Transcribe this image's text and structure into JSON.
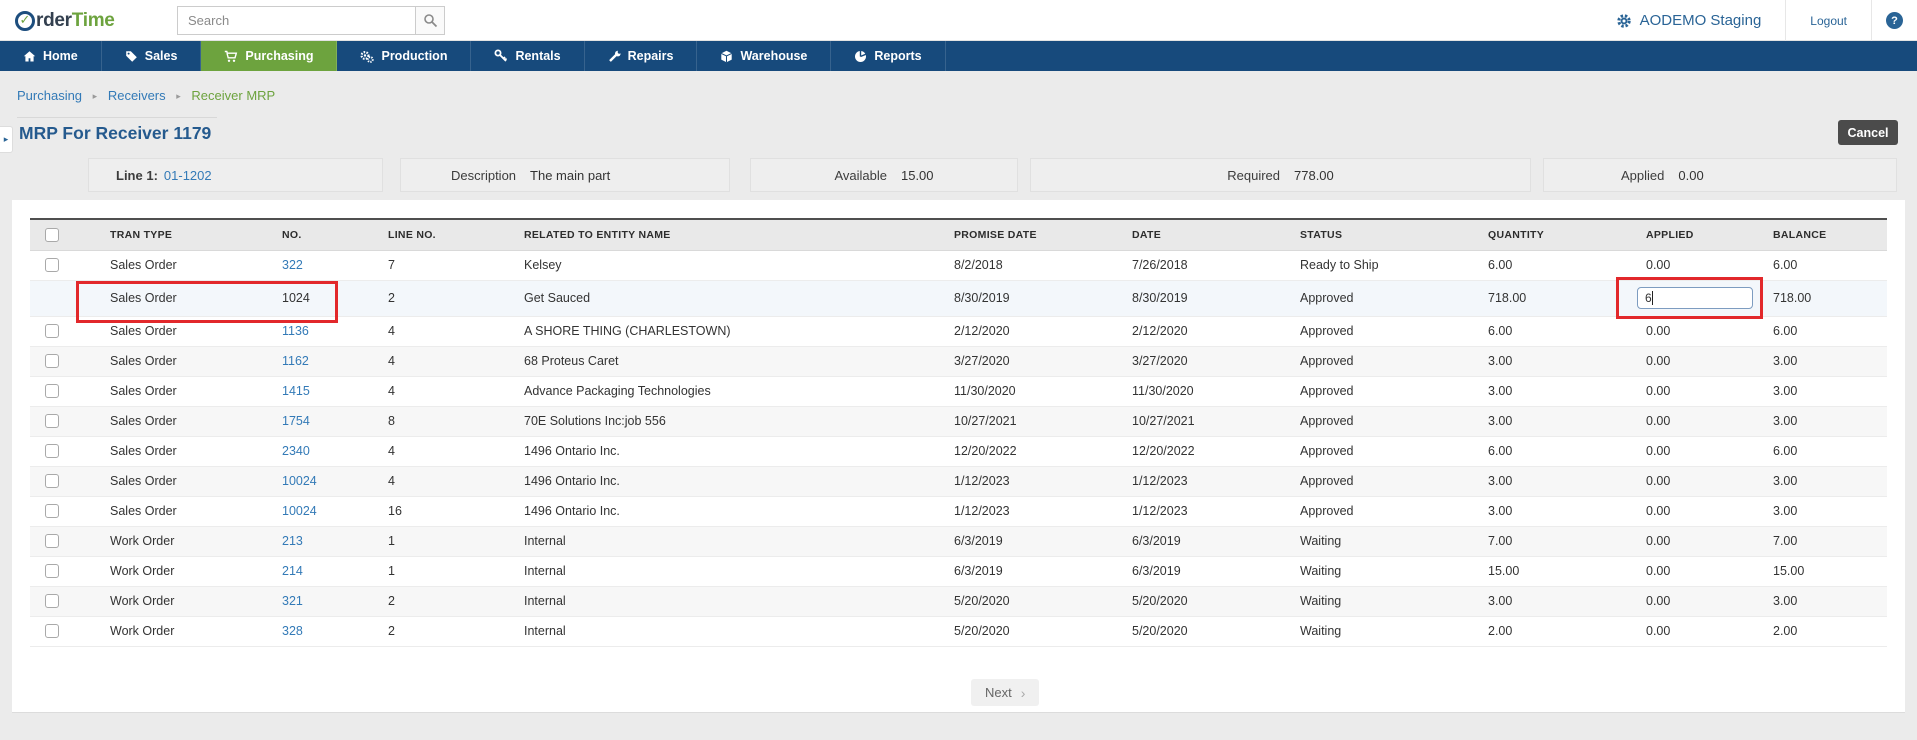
{
  "brand": {
    "logo_prefix": "rder",
    "logo_suffix": "Time",
    "logo_check": "✓"
  },
  "topbar": {
    "search_placeholder": "Search",
    "account_label": "AODEMO Staging",
    "logout_label": "Logout",
    "help_label": "?"
  },
  "nav": {
    "items": [
      {
        "label": "Home",
        "icon": "home-icon",
        "active": false
      },
      {
        "label": "Sales",
        "icon": "tag-icon",
        "active": false
      },
      {
        "label": "Purchasing",
        "icon": "cart-icon",
        "active": true
      },
      {
        "label": "Production",
        "icon": "gears-icon",
        "active": false
      },
      {
        "label": "Rentals",
        "icon": "key-icon",
        "active": false
      },
      {
        "label": "Repairs",
        "icon": "wrench-icon",
        "active": false
      },
      {
        "label": "Warehouse",
        "icon": "cube-icon",
        "active": false
      },
      {
        "label": "Reports",
        "icon": "pie-chart-icon",
        "active": false
      }
    ]
  },
  "breadcrumb": {
    "items": [
      "Purchasing",
      "Receivers",
      "Receiver MRP"
    ]
  },
  "page": {
    "title": "MRP For Receiver 1179",
    "cancel_label": "Cancel"
  },
  "summary": {
    "line_label": "Line 1:",
    "line_value": "01-1202",
    "description_label": "Description",
    "description_value": "The main part",
    "available_label": "Available",
    "available_value": "15.00",
    "required_label": "Required",
    "required_value": "778.00",
    "applied_label": "Applied",
    "applied_value": "0.00"
  },
  "table": {
    "columns": [
      "TRAN TYPE",
      "NO.",
      "LINE NO.",
      "RELATED TO ENTITY NAME",
      "PROMISE DATE",
      "DATE",
      "STATUS",
      "QUANTITY",
      "APPLIED",
      "BALANCE"
    ],
    "rows": [
      {
        "tran_type": "Sales Order",
        "no": "322",
        "line_no": "7",
        "entity": "Kelsey",
        "promise_date": "8/2/2018",
        "date": "7/26/2018",
        "status": "Ready to Ship",
        "quantity": "6.00",
        "applied": "0.00",
        "balance": "6.00",
        "highlighted": false
      },
      {
        "tran_type": "Sales Order",
        "no": "1024",
        "line_no": "2",
        "entity": "Get Sauced",
        "promise_date": "8/30/2019",
        "date": "8/30/2019",
        "status": "Approved",
        "quantity": "718.00",
        "applied": "",
        "balance": "718.00",
        "highlighted": true,
        "applied_input_value": "6"
      },
      {
        "tran_type": "Sales Order",
        "no": "1136",
        "line_no": "4",
        "entity": "A SHORE THING (CHARLESTOWN)",
        "promise_date": "2/12/2020",
        "date": "2/12/2020",
        "status": "Approved",
        "quantity": "6.00",
        "applied": "0.00",
        "balance": "6.00",
        "highlighted": false
      },
      {
        "tran_type": "Sales Order",
        "no": "1162",
        "line_no": "4",
        "entity": "68 Proteus Caret",
        "promise_date": "3/27/2020",
        "date": "3/27/2020",
        "status": "Approved",
        "quantity": "3.00",
        "applied": "0.00",
        "balance": "3.00",
        "highlighted": false
      },
      {
        "tran_type": "Sales Order",
        "no": "1415",
        "line_no": "4",
        "entity": "Advance Packaging Technologies",
        "promise_date": "11/30/2020",
        "date": "11/30/2020",
        "status": "Approved",
        "quantity": "3.00",
        "applied": "0.00",
        "balance": "3.00",
        "highlighted": false
      },
      {
        "tran_type": "Sales Order",
        "no": "1754",
        "line_no": "8",
        "entity": "70E Solutions Inc:job 556",
        "promise_date": "10/27/2021",
        "date": "10/27/2021",
        "status": "Approved",
        "quantity": "3.00",
        "applied": "0.00",
        "balance": "3.00",
        "highlighted": false
      },
      {
        "tran_type": "Sales Order",
        "no": "2340",
        "line_no": "4",
        "entity": "1496 Ontario Inc.",
        "promise_date": "12/20/2022",
        "date": "12/20/2022",
        "status": "Approved",
        "quantity": "6.00",
        "applied": "0.00",
        "balance": "6.00",
        "highlighted": false
      },
      {
        "tran_type": "Sales Order",
        "no": "10024",
        "line_no": "4",
        "entity": "1496 Ontario Inc.",
        "promise_date": "1/12/2023",
        "date": "1/12/2023",
        "status": "Approved",
        "quantity": "3.00",
        "applied": "0.00",
        "balance": "3.00",
        "highlighted": false
      },
      {
        "tran_type": "Sales Order",
        "no": "10024",
        "line_no": "16",
        "entity": "1496 Ontario Inc.",
        "promise_date": "1/12/2023",
        "date": "1/12/2023",
        "status": "Approved",
        "quantity": "3.00",
        "applied": "0.00",
        "balance": "3.00",
        "highlighted": false
      },
      {
        "tran_type": "Work Order",
        "no": "213",
        "line_no": "1",
        "entity": "Internal",
        "promise_date": "6/3/2019",
        "date": "6/3/2019",
        "status": "Waiting",
        "quantity": "7.00",
        "applied": "0.00",
        "balance": "7.00",
        "highlighted": false
      },
      {
        "tran_type": "Work Order",
        "no": "214",
        "line_no": "1",
        "entity": "Internal",
        "promise_date": "6/3/2019",
        "date": "6/3/2019",
        "status": "Waiting",
        "quantity": "15.00",
        "applied": "0.00",
        "balance": "15.00",
        "highlighted": false
      },
      {
        "tran_type": "Work Order",
        "no": "321",
        "line_no": "2",
        "entity": "Internal",
        "promise_date": "5/20/2020",
        "date": "5/20/2020",
        "status": "Waiting",
        "quantity": "3.00",
        "applied": "0.00",
        "balance": "3.00",
        "highlighted": false
      },
      {
        "tran_type": "Work Order",
        "no": "328",
        "line_no": "2",
        "entity": "Internal",
        "promise_date": "5/20/2020",
        "date": "5/20/2020",
        "status": "Waiting",
        "quantity": "2.00",
        "applied": "0.00",
        "balance": "2.00",
        "highlighted": false
      }
    ]
  },
  "pagination": {
    "next_label": "Next"
  },
  "colors": {
    "navy": "#174a7c",
    "green": "#6da33e",
    "link_blue": "#337ab7",
    "title_blue": "#255a8e",
    "highlight_red": "#e2282b"
  }
}
